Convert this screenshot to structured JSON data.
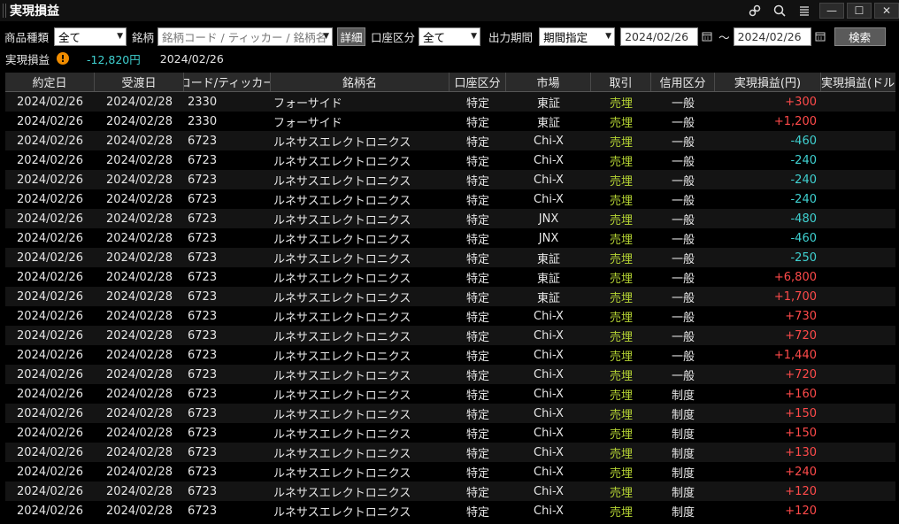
{
  "window": {
    "title": "実現損益"
  },
  "toolbar_icons": [
    "link-icon",
    "search-icon",
    "menu-icon"
  ],
  "window_buttons": {
    "minimize": "—",
    "maximize": "☐",
    "close": "✕"
  },
  "filters": {
    "product_type_label": "商品種類",
    "product_type_value": "全て",
    "symbol_label": "銘柄",
    "symbol_placeholder": "銘柄コード / ティッカー / 銘柄名",
    "detail_button": "詳細",
    "account_label": "口座区分",
    "account_value": "全て",
    "period_label": "出力期間",
    "period_value": "期間指定",
    "date_from": "2024/02/26",
    "date_sep": "～",
    "date_to": "2024/02/26",
    "search_button": "検索"
  },
  "summary": {
    "label": "実現損益",
    "warning": "!",
    "total": "-12,820円",
    "date": "2024/02/26"
  },
  "colors": {
    "negative": "#3fd1d1",
    "positive": "#ff4a4a",
    "trade": "#b5d334"
  },
  "table": {
    "headers": [
      "約定日",
      "受渡日",
      "コード/ティッカー",
      "銘柄名",
      "口座区分",
      "市場",
      "取引",
      "信用区分",
      "実現損益(円)",
      "実現損益(ドル"
    ],
    "rows": [
      [
        "2024/02/26",
        "2024/02/28",
        "2330",
        "フォーサイド",
        "特定",
        "東証",
        "売埋",
        "一般",
        "+300"
      ],
      [
        "2024/02/26",
        "2024/02/28",
        "2330",
        "フォーサイド",
        "特定",
        "東証",
        "売埋",
        "一般",
        "+1,200"
      ],
      [
        "2024/02/26",
        "2024/02/28",
        "6723",
        "ルネサスエレクトロニクス",
        "特定",
        "Chi-X",
        "売埋",
        "一般",
        "-460"
      ],
      [
        "2024/02/26",
        "2024/02/28",
        "6723",
        "ルネサスエレクトロニクス",
        "特定",
        "Chi-X",
        "売埋",
        "一般",
        "-240"
      ],
      [
        "2024/02/26",
        "2024/02/28",
        "6723",
        "ルネサスエレクトロニクス",
        "特定",
        "Chi-X",
        "売埋",
        "一般",
        "-240"
      ],
      [
        "2024/02/26",
        "2024/02/28",
        "6723",
        "ルネサスエレクトロニクス",
        "特定",
        "Chi-X",
        "売埋",
        "一般",
        "-240"
      ],
      [
        "2024/02/26",
        "2024/02/28",
        "6723",
        "ルネサスエレクトロニクス",
        "特定",
        "JNX",
        "売埋",
        "一般",
        "-480"
      ],
      [
        "2024/02/26",
        "2024/02/28",
        "6723",
        "ルネサスエレクトロニクス",
        "特定",
        "JNX",
        "売埋",
        "一般",
        "-460"
      ],
      [
        "2024/02/26",
        "2024/02/28",
        "6723",
        "ルネサスエレクトロニクス",
        "特定",
        "東証",
        "売埋",
        "一般",
        "-250"
      ],
      [
        "2024/02/26",
        "2024/02/28",
        "6723",
        "ルネサスエレクトロニクス",
        "特定",
        "東証",
        "売埋",
        "一般",
        "+6,800"
      ],
      [
        "2024/02/26",
        "2024/02/28",
        "6723",
        "ルネサスエレクトロニクス",
        "特定",
        "東証",
        "売埋",
        "一般",
        "+1,700"
      ],
      [
        "2024/02/26",
        "2024/02/28",
        "6723",
        "ルネサスエレクトロニクス",
        "特定",
        "Chi-X",
        "売埋",
        "一般",
        "+730"
      ],
      [
        "2024/02/26",
        "2024/02/28",
        "6723",
        "ルネサスエレクトロニクス",
        "特定",
        "Chi-X",
        "売埋",
        "一般",
        "+720"
      ],
      [
        "2024/02/26",
        "2024/02/28",
        "6723",
        "ルネサスエレクトロニクス",
        "特定",
        "Chi-X",
        "売埋",
        "一般",
        "+1,440"
      ],
      [
        "2024/02/26",
        "2024/02/28",
        "6723",
        "ルネサスエレクトロニクス",
        "特定",
        "Chi-X",
        "売埋",
        "一般",
        "+720"
      ],
      [
        "2024/02/26",
        "2024/02/28",
        "6723",
        "ルネサスエレクトロニクス",
        "特定",
        "Chi-X",
        "売埋",
        "制度",
        "+160"
      ],
      [
        "2024/02/26",
        "2024/02/28",
        "6723",
        "ルネサスエレクトロニクス",
        "特定",
        "Chi-X",
        "売埋",
        "制度",
        "+150"
      ],
      [
        "2024/02/26",
        "2024/02/28",
        "6723",
        "ルネサスエレクトロニクス",
        "特定",
        "Chi-X",
        "売埋",
        "制度",
        "+150"
      ],
      [
        "2024/02/26",
        "2024/02/28",
        "6723",
        "ルネサスエレクトロニクス",
        "特定",
        "Chi-X",
        "売埋",
        "制度",
        "+130"
      ],
      [
        "2024/02/26",
        "2024/02/28",
        "6723",
        "ルネサスエレクトロニクス",
        "特定",
        "Chi-X",
        "売埋",
        "制度",
        "+240"
      ],
      [
        "2024/02/26",
        "2024/02/28",
        "6723",
        "ルネサスエレクトロニクス",
        "特定",
        "Chi-X",
        "売埋",
        "制度",
        "+120"
      ],
      [
        "2024/02/26",
        "2024/02/28",
        "6723",
        "ルネサスエレクトロニクス",
        "特定",
        "Chi-X",
        "売埋",
        "制度",
        "+120"
      ]
    ]
  }
}
